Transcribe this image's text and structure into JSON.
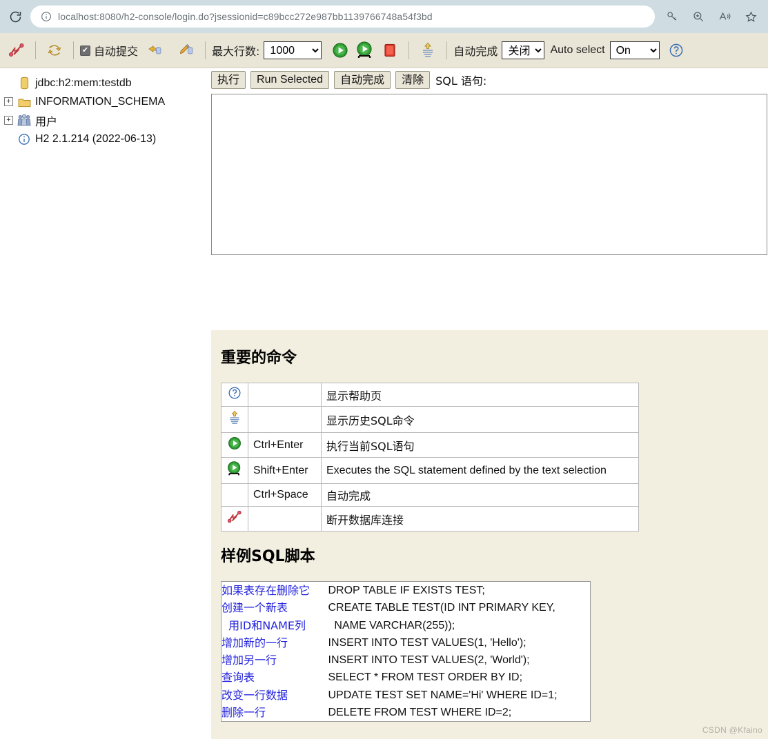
{
  "browser": {
    "reload_icon": "reload-icon",
    "info_icon": "info-icon",
    "url_host": "localhost:8080",
    "url_path": "/h2-console/login.do?jsessionid=c89bcc272e987bb1139766748a54f3bd",
    "url_full": "localhost:8080/h2-console/login.do?jsessionid=c89bcc272e987bb1139766748a54f3bd",
    "actions": [
      {
        "name": "key-icon",
        "label": "key-icon"
      },
      {
        "name": "zoom-icon",
        "label": "zoom-icon"
      },
      {
        "name": "read-aloud-icon",
        "label": "read-aloud-icon"
      },
      {
        "name": "favorite-star-icon",
        "label": "favorite-star-icon"
      }
    ]
  },
  "toolbar": {
    "disconnect_icon": "disconnect-icon",
    "refresh_icon": "refresh-icon",
    "autocommit_label": "自动提交",
    "autocommit_checked": true,
    "commit_icon": "commit-icon",
    "rollback_icon": "rollback-icon",
    "maxrows_label": "最大行数:",
    "maxrows_value": "1000",
    "maxrows_options": [
      "1000"
    ],
    "run_icon": "run-icon",
    "run_selected_icon": "run-selected-icon",
    "stop_icon": "stop-icon",
    "history_icon": "history-icon",
    "autocomplete_label": "自动完成",
    "autocomplete_value": "关闭",
    "autocomplete_options": [
      "关闭"
    ],
    "autoselect_label": "Auto select",
    "autoselect_value": "On",
    "autoselect_options": [
      "On"
    ],
    "help_icon": "help-icon"
  },
  "tree": {
    "items": [
      {
        "label": "jdbc:h2:mem:testdb",
        "icon": "database-icon",
        "expandable": false
      },
      {
        "label": "INFORMATION_SCHEMA",
        "icon": "folder-icon",
        "expandable": true
      },
      {
        "label": "用户",
        "icon": "users-icon",
        "expandable": true
      },
      {
        "label": "H2 2.1.214 (2022-06-13)",
        "icon": "info-circle-icon",
        "expandable": false
      }
    ]
  },
  "sql": {
    "run_label": "执行",
    "run_selected_label": "Run Selected",
    "autocomplete_label": "自动完成",
    "clear_label": "清除",
    "caption": "SQL 语句:",
    "textarea_value": "",
    "textarea_placeholder": ""
  },
  "help": {
    "commands_title": "重要的命令",
    "commands_rows": [
      {
        "icon": "help-icon",
        "key": "",
        "desc": "显示帮助页"
      },
      {
        "icon": "history-icon",
        "key": "",
        "desc": "显示历史SQL命令"
      },
      {
        "icon": "run-icon",
        "key": "Ctrl+Enter",
        "desc": "执行当前SQL语句"
      },
      {
        "icon": "run-selected-icon",
        "key": "Shift+Enter",
        "desc": "Executes the SQL statement defined by the text selection"
      },
      {
        "icon": "",
        "key": "Ctrl+Space",
        "desc": "自动完成"
      },
      {
        "icon": "disconnect-icon",
        "key": "",
        "desc": "断开数据库连接"
      }
    ],
    "sample_title": "样例SQL脚本",
    "sample_rows": [
      {
        "comment": "如果表存在删除它",
        "sql": "DROP TABLE IF EXISTS TEST;"
      },
      {
        "comment": "创建一个新表",
        "sql": "CREATE TABLE TEST(ID INT PRIMARY KEY,"
      },
      {
        "comment": "  用ID和NAME列",
        "sql": "  NAME VARCHAR(255));"
      },
      {
        "comment": "增加新的一行",
        "sql": "INSERT INTO TEST VALUES(1, 'Hello');"
      },
      {
        "comment": "增加另一行",
        "sql": "INSERT INTO TEST VALUES(2, 'World');"
      },
      {
        "comment": "查询表",
        "sql": "SELECT * FROM TEST ORDER BY ID;"
      },
      {
        "comment": "改变一行数据",
        "sql": "UPDATE TEST SET NAME='Hi' WHERE ID=1;"
      },
      {
        "comment": "删除一行",
        "sql": "DELETE FROM TEST WHERE ID=2;"
      }
    ]
  },
  "watermark": "CSDN @Kfaino",
  "colors": {
    "browser_chrome": "#cfdde2",
    "toolbar_bg": "#eae6d7",
    "content_bg": "#f2efe0",
    "button_bg": "#eae6d7",
    "link_blue": "#2222dd",
    "run_green": "#2f9e32",
    "stop_red": "#e03a2a"
  }
}
